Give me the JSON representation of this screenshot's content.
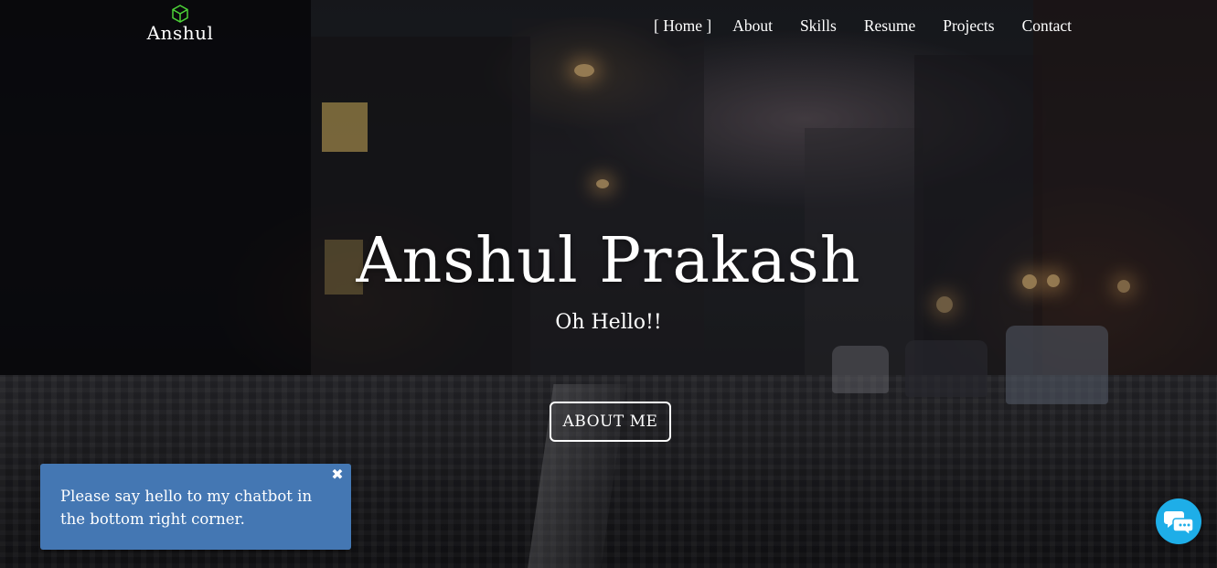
{
  "brand": {
    "logo_text": "Anshul",
    "logo_icon": "cube-icon",
    "accent_color": "#4cd137"
  },
  "nav": {
    "items": [
      {
        "label": "Home",
        "active": true
      },
      {
        "label": "About",
        "active": false
      },
      {
        "label": "Skills",
        "active": false
      },
      {
        "label": "Resume",
        "active": false
      },
      {
        "label": "Projects",
        "active": false
      },
      {
        "label": "Contact",
        "active": false
      }
    ]
  },
  "hero": {
    "title": "Anshul Prakash",
    "subtitle": "Oh Hello!!",
    "cta_label": "ABOUT ME"
  },
  "chat": {
    "popup_text": "Please say hello to my chatbot in the bottom right corner.",
    "close_icon": "close-icon",
    "launcher_icon": "chat-bubbles-icon",
    "popup_color": "#4477b3",
    "launcher_color": "#1eaee8"
  }
}
